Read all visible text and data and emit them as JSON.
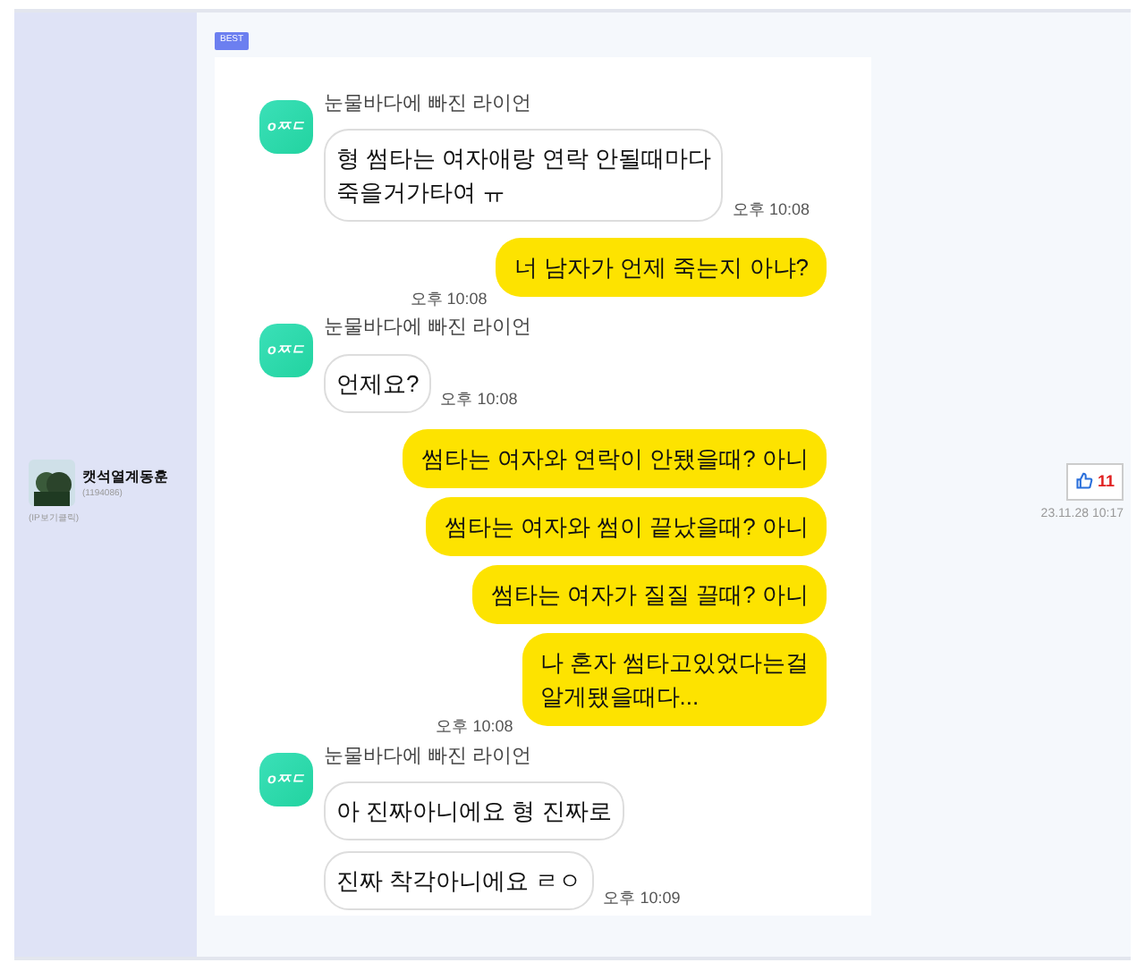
{
  "author": {
    "name": "캣석열계동훈",
    "id": "(1194086)",
    "ip_link": "(IP보기클릭)"
  },
  "badge": "BEST",
  "chat": [
    {
      "kind": "received",
      "sender": "눈물바다에 빠진 라이언",
      "avatar_text": "oㅉㄷ",
      "bubbles": [
        "형 썸타는 여자애랑 연락 안될때마다\n죽을거가타여 ㅠ"
      ],
      "time": "오후 10:08"
    },
    {
      "kind": "sent",
      "bubbles": [
        "너 남자가 언제 죽는지 아냐?"
      ],
      "time": "오후 10:08"
    },
    {
      "kind": "received",
      "sender": "눈물바다에 빠진 라이언",
      "avatar_text": "oㅉㄷ",
      "bubbles": [
        "언제요?"
      ],
      "time": "오후 10:08"
    },
    {
      "kind": "sent",
      "bubbles": [
        "썸타는 여자와 연락이 안됐을때? 아니",
        "썸타는 여자와 썸이 끝났을때? 아니",
        "썸타는 여자가 질질 끌때? 아니",
        "나 혼자 썸타고있었다는걸\n알게됐을때다..."
      ],
      "time": "오후 10:08"
    },
    {
      "kind": "received",
      "sender": "눈물바다에 빠진 라이언",
      "avatar_text": "oㅉㄷ",
      "bubbles": [
        "아 진짜아니에요 형 진짜로",
        "진짜 착각아니에요 ㄹㅇ"
      ],
      "time": "오후 10:09"
    }
  ],
  "likes": "11",
  "date": "23.11.28 10:17"
}
